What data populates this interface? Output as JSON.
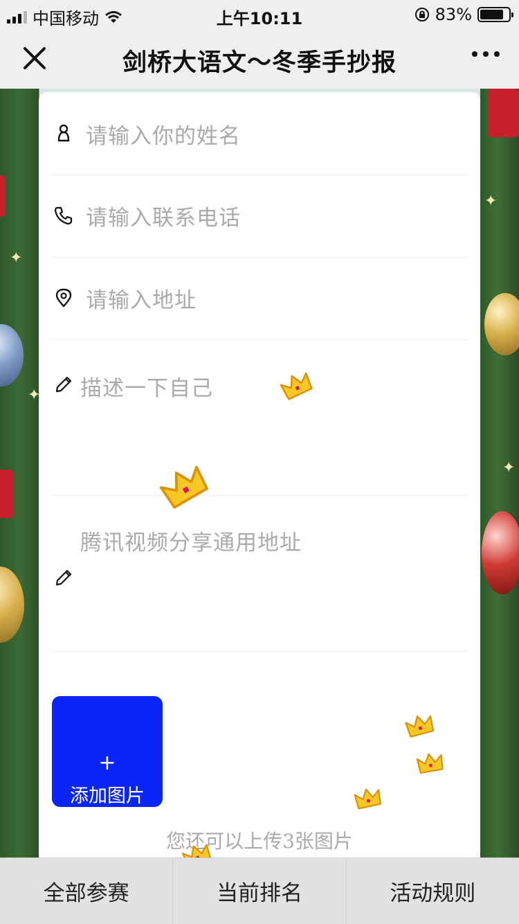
{
  "status_bar": {
    "carrier": "中国移动",
    "time": "上午10:11",
    "battery_percent": "83%",
    "battery_level": 0.83,
    "icons": [
      "signal-icon",
      "wifi-icon",
      "orientation-lock-icon",
      "battery-icon"
    ]
  },
  "nav": {
    "title": "剑桥大语文～冬季手抄报",
    "close_icon": "close-icon",
    "more_icon": "more-icon"
  },
  "form": {
    "name_placeholder": "请输入你的姓名",
    "phone_placeholder": "请输入联系电话",
    "address_placeholder": "请输入地址",
    "description_placeholder": "描述一下自己",
    "video_placeholder": "腾讯视频分享通用地址",
    "icons": {
      "name": "person-icon",
      "phone": "phone-icon",
      "address": "location-pin-icon",
      "description": "pencil-icon",
      "video": "pencil-icon"
    }
  },
  "upload": {
    "plus": "+",
    "label": "添加图片",
    "remaining_text": "您还可以上传3张图片",
    "accent_color": "#0a25f7"
  },
  "tabs": [
    {
      "label": "全部参赛"
    },
    {
      "label": "当前排名"
    },
    {
      "label": "活动规则"
    }
  ]
}
